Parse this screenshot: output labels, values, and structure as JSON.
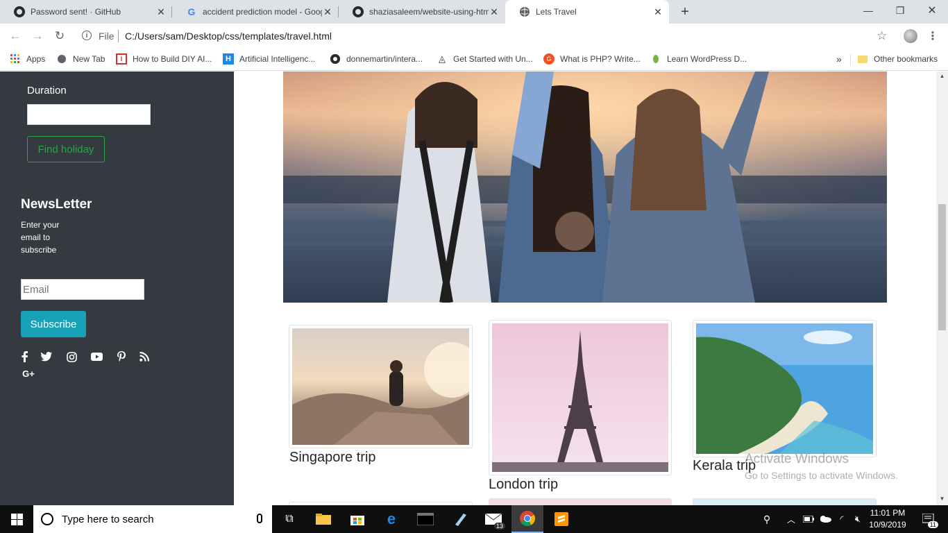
{
  "browser": {
    "tabs": [
      {
        "title": "Password sent! · GitHub"
      },
      {
        "title": "accident prediction model - Goog"
      },
      {
        "title": "shaziasaleem/website-using-htm"
      },
      {
        "title": "Lets Travel"
      }
    ],
    "file_label": "File",
    "url": "C:/Users/sam/Desktop/css/templates/travel.html",
    "bookmarks": [
      {
        "label": "Apps"
      },
      {
        "label": "New Tab"
      },
      {
        "label": "How to Build DIY AI..."
      },
      {
        "label": "Artificial Intelligenc..."
      },
      {
        "label": "donnemartin/intera..."
      },
      {
        "label": "Get Started with Un..."
      },
      {
        "label": "What is PHP? Write..."
      },
      {
        "label": "Learn WordPress D..."
      }
    ],
    "overflow": "»",
    "other_bookmarks": "Other bookmarks"
  },
  "sidebar": {
    "duration_label": "Duration",
    "find_button": "Find holiday",
    "newsletter_title": "NewsLetter",
    "newsletter_text": "Enter your email to subscribe",
    "email_placeholder": "Email",
    "subscribe_button": "Subscribe",
    "social_icons": [
      "facebook-icon",
      "twitter-icon",
      "instagram-icon",
      "youtube-icon",
      "pinterest-icon",
      "rss-icon",
      "google-plus-icon"
    ],
    "google_plus_glyph": "G+"
  },
  "trips": [
    {
      "caption": "Singapore trip"
    },
    {
      "caption": "London trip"
    },
    {
      "caption": "Kerala trip"
    }
  ],
  "watermark": {
    "line1": "Activate Windows",
    "line2": "Go to Settings to activate Windows."
  },
  "taskbar": {
    "search_placeholder": "Type here to search",
    "mail_badge": "13",
    "time": "11:01 PM",
    "date": "10/9/2019",
    "notification_count": "11"
  },
  "colors": {
    "sidebar_bg": "#343a40",
    "success": "#28a745",
    "info": "#17a2b8"
  }
}
